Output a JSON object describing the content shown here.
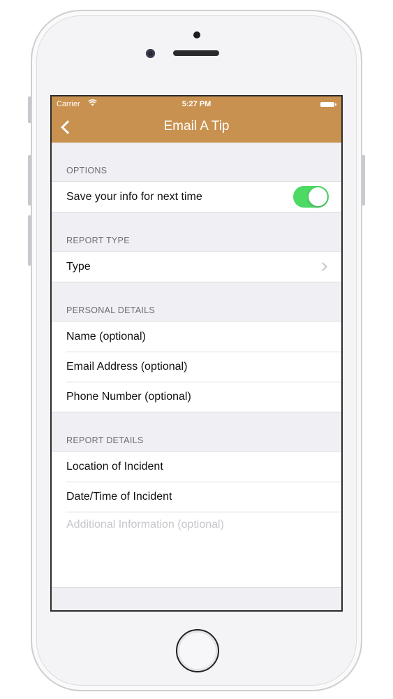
{
  "status_bar": {
    "carrier": "Carrier",
    "time": "5:27 PM"
  },
  "nav": {
    "title": "Email A Tip",
    "back_icon": "chevron-left-icon"
  },
  "colors": {
    "header": "#c9914f",
    "toggle_on": "#4cd964"
  },
  "options": {
    "header": "OPTIONS",
    "save_info_label": "Save your info for next time",
    "save_info_enabled": true
  },
  "report_type": {
    "header": "REPORT TYPE",
    "type_label": "Type"
  },
  "personal_details": {
    "header": "PERSONAL DETAILS",
    "fields": [
      {
        "label": "Name (optional)"
      },
      {
        "label": "Email Address (optional)"
      },
      {
        "label": "Phone Number (optional)"
      }
    ]
  },
  "report_details": {
    "header": "REPORT DETAILS",
    "location_label": "Location of Incident",
    "datetime_label": "Date/Time of Incident",
    "additional_placeholder": "Additional Information (optional)"
  }
}
